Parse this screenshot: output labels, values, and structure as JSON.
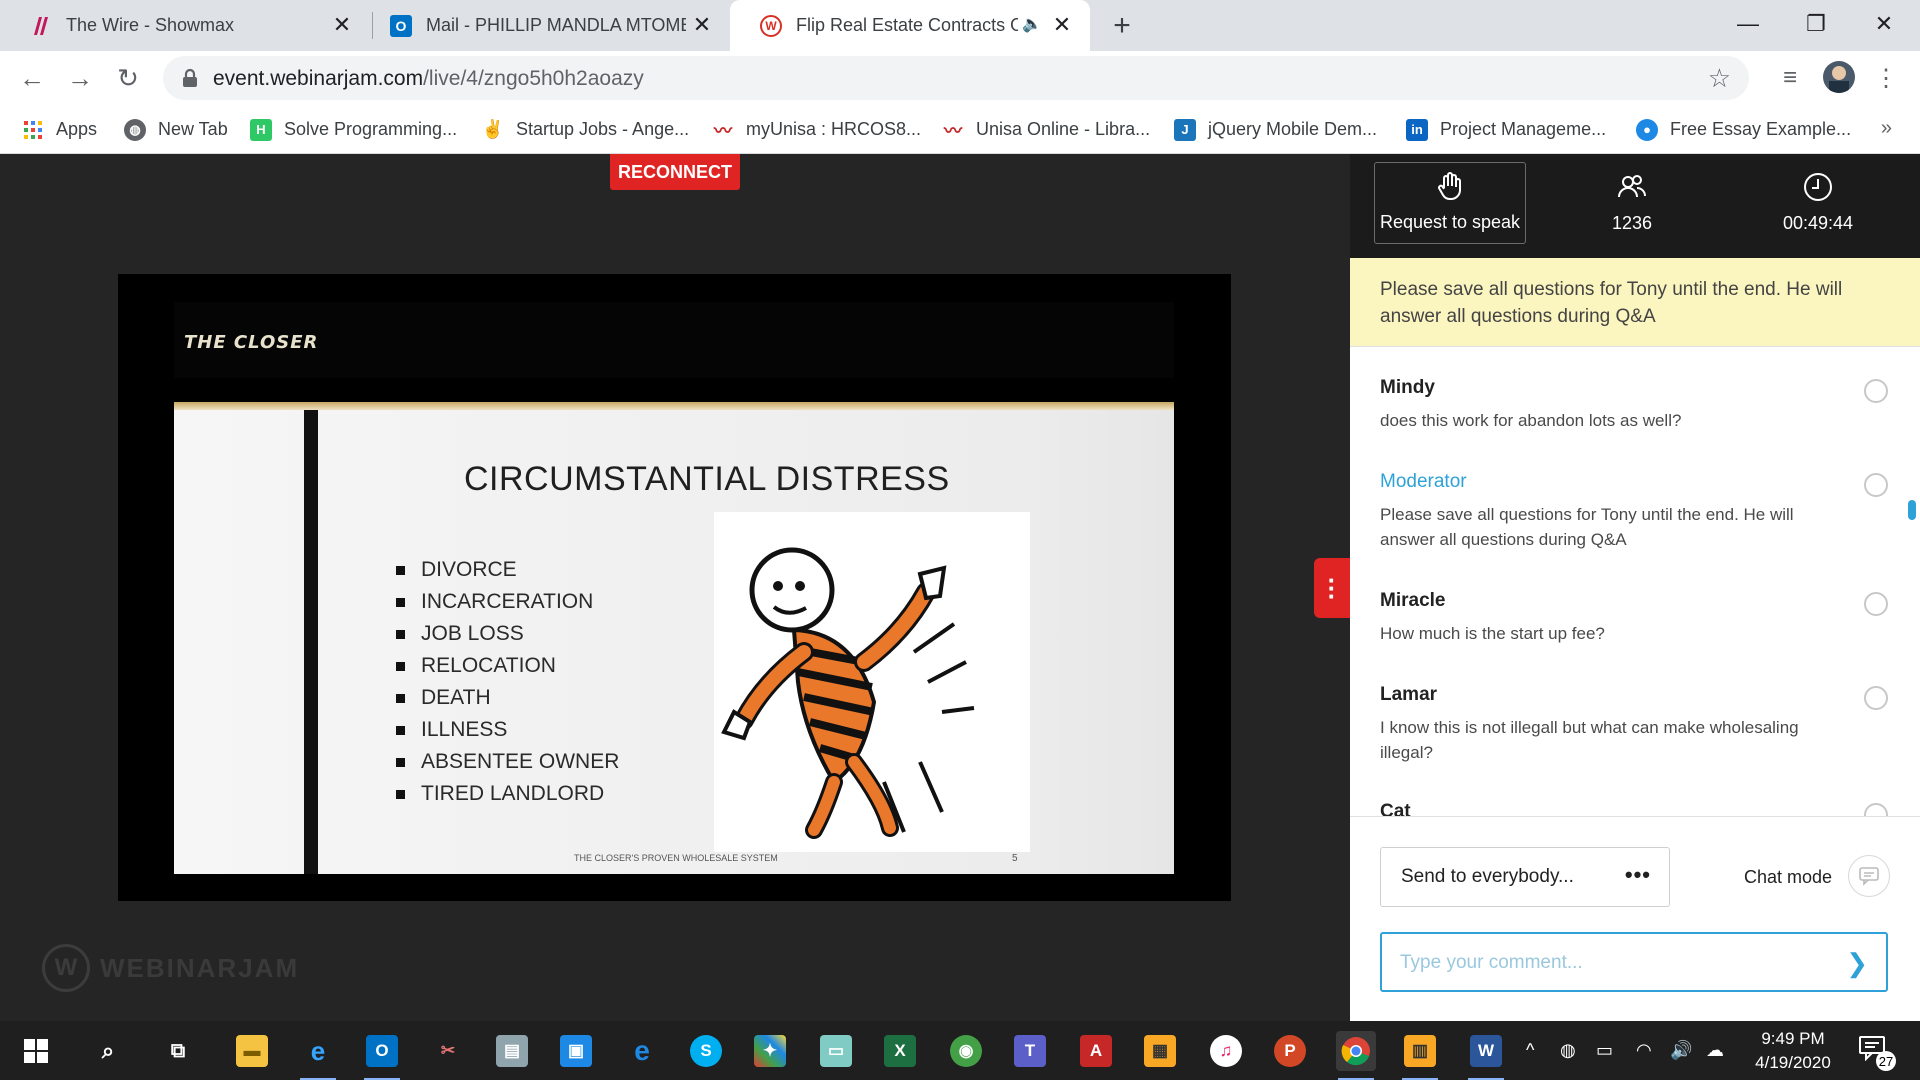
{
  "browser": {
    "tabs": [
      {
        "title": "The Wire - Showmax",
        "icon": "showmax-icon",
        "color": "#e1306c"
      },
      {
        "title": "Mail - PHILLIP MANDLA MTOMBENI",
        "icon": "outlook-icon",
        "color": "#0072c6"
      },
      {
        "title": "Flip Real Estate Contracts Of",
        "icon": "webinarjam-icon",
        "color": "#d93025"
      }
    ],
    "url_domain": "event.webinarjam.com",
    "url_path": "/live/4/zngo5h0h2aoazy",
    "bookmarks": [
      {
        "label": "Apps",
        "icon": "apps-grid-icon"
      },
      {
        "label": "New Tab",
        "icon": "globe-icon"
      },
      {
        "label": "Solve Programming...",
        "icon": "hackerrank-icon"
      },
      {
        "label": "Startup Jobs - Ange...",
        "icon": "angellist-icon"
      },
      {
        "label": "myUnisa : HRCOS8...",
        "icon": "unisa-icon"
      },
      {
        "label": "Unisa Online - Libra...",
        "icon": "unisa-icon"
      },
      {
        "label": "jQuery Mobile Dem...",
        "icon": "jquery-icon"
      },
      {
        "label": "Project Manageme...",
        "icon": "linkedin-icon"
      },
      {
        "label": "Free Essay Example...",
        "icon": "essay-icon"
      }
    ],
    "bookmarks_more": "»"
  },
  "webinar": {
    "reconnect_label": "RECONNECT",
    "slide": {
      "logo_text": "THE CLOSER",
      "title": "CIRCUMSTANTIAL DISTRESS",
      "bullets": [
        "DIVORCE",
        "INCARCERATION",
        "JOB LOSS",
        "RELOCATION",
        "DEATH",
        "ILLNESS",
        "ABSENTEE OWNER",
        "TIRED LANDLORD"
      ],
      "footer": "THE CLOSER'S PROVEN WHOLESALE SYSTEM",
      "page_number": "5"
    },
    "brand": "WEBINARJAM",
    "brand_mark": "W"
  },
  "panel": {
    "request_to_speak": "Request to speak",
    "attendees": "1236",
    "elapsed": "00:49:44",
    "notice": "Please save all questions for Tony until the end. He will answer all questions during Q&A",
    "messages": [
      {
        "name": "Mindy",
        "text": "does this work for abandon lots as well?",
        "moderator": false
      },
      {
        "name": "Moderator",
        "text": "Please save all questions for Tony until the end. He will answer all questions during Q&A",
        "moderator": true
      },
      {
        "name": "Miracle",
        "text": "How much is the start up fee?",
        "moderator": false
      },
      {
        "name": "Lamar",
        "text": "I know this is not illegall but what can make wholesaling illegal?",
        "moderator": false
      },
      {
        "name": "Cat",
        "text": "",
        "moderator": false
      }
    ],
    "send_to": "Send to everybody...",
    "more_dots": "•••",
    "chat_mode": "Chat mode",
    "comment_placeholder": "Type your comment...",
    "accent_color": "#2ea2d8"
  },
  "taskbar": {
    "time": "9:49 PM",
    "date": "4/19/2020",
    "notifications": "27",
    "apps": [
      "windows-start-icon",
      "search-icon",
      "task-view-icon",
      "file-explorer-icon",
      "internet-explorer-icon",
      "outlook-icon",
      "snipping-icon",
      "paint-icon",
      "network-icon",
      "edge-icon",
      "skype-icon",
      "winrar-icon",
      "notepad-icon",
      "excel-icon",
      "xbox-icon",
      "teams-icon",
      "acrobat-icon",
      "archive-icon",
      "itunes-icon",
      "powerpoint-icon",
      "chrome-icon",
      "notes-icon",
      "word-icon"
    ]
  }
}
